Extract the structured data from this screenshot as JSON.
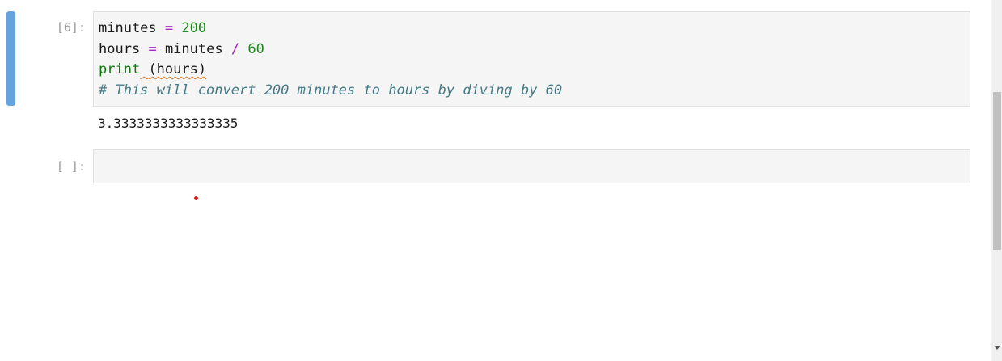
{
  "cells": [
    {
      "prompt": "[6]:",
      "code": {
        "line1": {
          "var": "minutes",
          "op": "=",
          "num": "200"
        },
        "line2": {
          "var": "hours",
          "op": "=",
          "var2": "minutes",
          "op2": "/",
          "num": "60"
        },
        "line3": {
          "fn": "print",
          "args": "(hours)"
        },
        "line4": {
          "comment": "# This will convert 200 minutes to hours by diving by 60"
        }
      },
      "output": "3.3333333333333335"
    },
    {
      "prompt": "[ ]:"
    }
  ],
  "colors": {
    "active_bar": "#64a3e0",
    "operator": "#a626c8",
    "number": "#1b8a1b",
    "builtin": "#0b7a0b",
    "comment": "#437a86",
    "squiggle": "#e07a22"
  }
}
